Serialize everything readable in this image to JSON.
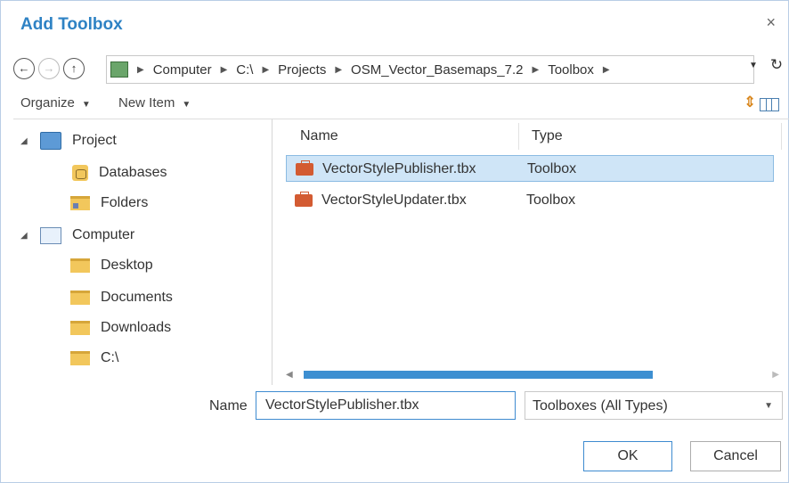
{
  "window": {
    "title": "Add Toolbox",
    "close_glyph": "×"
  },
  "address_bar": {
    "back_glyph": "←",
    "forward_glyph": "→",
    "up_glyph": "↑",
    "refresh_glyph": "↻",
    "location_icon": "map-location-icon",
    "breadcrumbs": [
      "Computer",
      "C:\\",
      "Projects",
      "OSM_Vector_Basemaps_7.2",
      "Toolbox"
    ]
  },
  "command_bar": {
    "organize_label": "Organize",
    "new_item_label": "New Item"
  },
  "tree": {
    "items": [
      {
        "label": "Project",
        "icon": "project-icon"
      },
      {
        "label": "Databases",
        "icon": "database-folder-icon"
      },
      {
        "label": "Folders",
        "icon": "folders-icon"
      },
      {
        "label": "Computer",
        "icon": "computer-icon"
      },
      {
        "label": "Desktop",
        "icon": "folder-icon"
      },
      {
        "label": "Documents",
        "icon": "folder-icon"
      },
      {
        "label": "Downloads",
        "icon": "folder-icon"
      },
      {
        "label": "C:\\",
        "icon": "folder-icon"
      }
    ]
  },
  "file_list": {
    "columns": [
      "Name",
      "Type"
    ],
    "rows": [
      {
        "name": "VectorStylePublisher.tbx",
        "type": "Toolbox",
        "selected": true
      },
      {
        "name": "VectorStyleUpdater.tbx",
        "type": "Toolbox",
        "selected": false
      }
    ]
  },
  "footer": {
    "name_label": "Name",
    "name_value": "VectorStylePublisher.tbx",
    "type_filter": "Toolboxes (All Types)",
    "ok_label": "OK",
    "cancel_label": "Cancel"
  },
  "colors": {
    "title": "#2e82c4",
    "selection": "#cfe5f7",
    "toolbox_icon": "#d35b32",
    "scroll_thumb": "#3d8fd1"
  }
}
